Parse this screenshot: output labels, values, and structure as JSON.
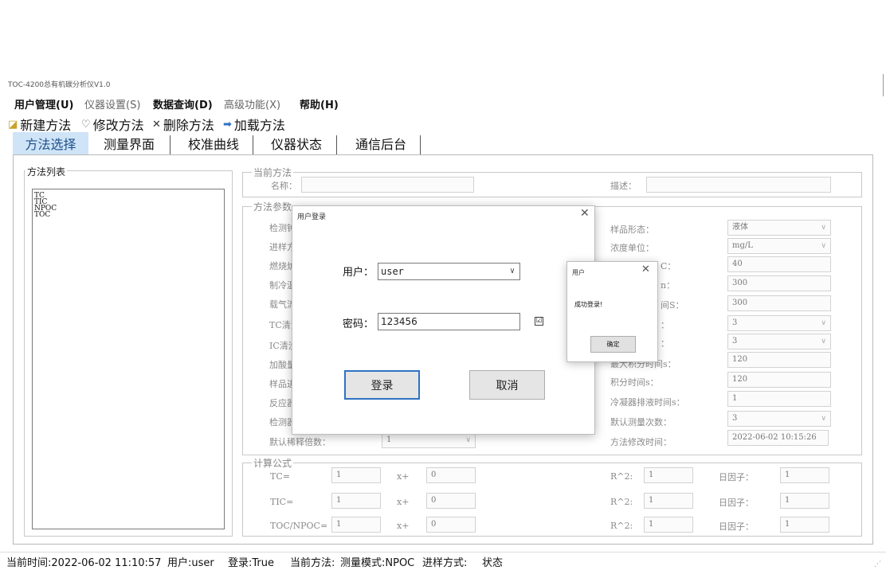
{
  "window": {
    "title": "TOC-4200总有机碳分析仪V1.0"
  },
  "menu": [
    "用户管理(U)",
    "仪器设置(S)",
    "数据查询(D)",
    "高级功能(X)",
    "帮助(H)"
  ],
  "toolbar": {
    "new_method": "新建方法",
    "edit_method": "修改方法",
    "delete_method": "删除方法",
    "load_method": "加载方法"
  },
  "tabs": [
    "方法选择",
    "测量界面",
    "校准曲线",
    "仪器状态",
    "通信后台"
  ],
  "method_list": {
    "title": "方法列表",
    "items": [
      "TC",
      "TIC",
      "NPOC",
      "TOC"
    ]
  },
  "current_method": {
    "title": "当前方法",
    "name_label": "名称：",
    "name_value": "",
    "desc_label": "描述：",
    "desc_value": ""
  },
  "params": {
    "title": "方法参数",
    "left_labels_visible": [
      "检测钟",
      "进样方",
      "燃烧炉",
      "制冷温",
      "载气流",
      "TC清洗",
      "IC清洗",
      "加酸量",
      "样品进",
      "反应器",
      "检测器"
    ],
    "default_dilution_label": "默认稀释倍数：",
    "default_dilution_value": "1",
    "right": [
      {
        "label": "样品形态：",
        "value": "液体",
        "dropdown": true
      },
      {
        "label": "浓度单位：",
        "value": "mg/L",
        "dropdown": true
      },
      {
        "label": "C：",
        "value": "40",
        "dropdown": false
      },
      {
        "label": "n：",
        "value": "300",
        "dropdown": false
      },
      {
        "label": "间S：",
        "value": "300",
        "dropdown": false
      },
      {
        "label": "：",
        "value": "3",
        "dropdown": true
      },
      {
        "label": "：",
        "value": "3",
        "dropdown": true
      },
      {
        "label": "最大积分时间s：",
        "value": "120",
        "dropdown": false
      },
      {
        "label": "积分时间s：",
        "value": "120",
        "dropdown": false
      },
      {
        "label": "冷凝器排液时间s：",
        "value": "1",
        "dropdown": false
      },
      {
        "label": "默认测量次数：",
        "value": "3",
        "dropdown": true
      },
      {
        "label": "方法修改时间：",
        "value": "2022-06-02 10:15:26",
        "dropdown": false
      }
    ]
  },
  "formula": {
    "title": "计算公式",
    "rows": [
      {
        "name": "TC=",
        "a": "1",
        "op": "x+",
        "b": "0",
        "r2_label": "R^2:",
        "r2": "1",
        "factor_label": "日因子：",
        "factor": "1"
      },
      {
        "name": "TIC=",
        "a": "1",
        "op": "x+",
        "b": "0",
        "r2_label": "R^2:",
        "r2": "1",
        "factor_label": "日因子：",
        "factor": "1"
      },
      {
        "name": "TOC/NPOC=",
        "a": "1",
        "op": "x+",
        "b": "0",
        "r2_label": "R^2:",
        "r2": "1",
        "factor_label": "日因子：",
        "factor": "1"
      }
    ]
  },
  "login_dialog": {
    "title": "用户登录",
    "close": "✕",
    "user_label": "用户：",
    "user_value": "user",
    "password_label": "密码：",
    "password_value": "123456",
    "show_password_check": "☑",
    "login_button": "登录",
    "cancel_button": "取消"
  },
  "message_box": {
    "title": "用户",
    "close": "✕",
    "text": "成功登录!",
    "ok_button": "确定"
  },
  "status_bar": {
    "time": "当前时间:2022-06-02 11:10:57",
    "user": "用户:user",
    "login": "登录:True",
    "method": "当前方法:",
    "mode": "测量模式:NPOC",
    "inject": "进样方式:",
    "state": "状态"
  },
  "colors": {
    "active_tab_bg": "#cfe4f7",
    "active_tab_text": "#1e4f8a",
    "default_button_border": "#2f72c4"
  }
}
